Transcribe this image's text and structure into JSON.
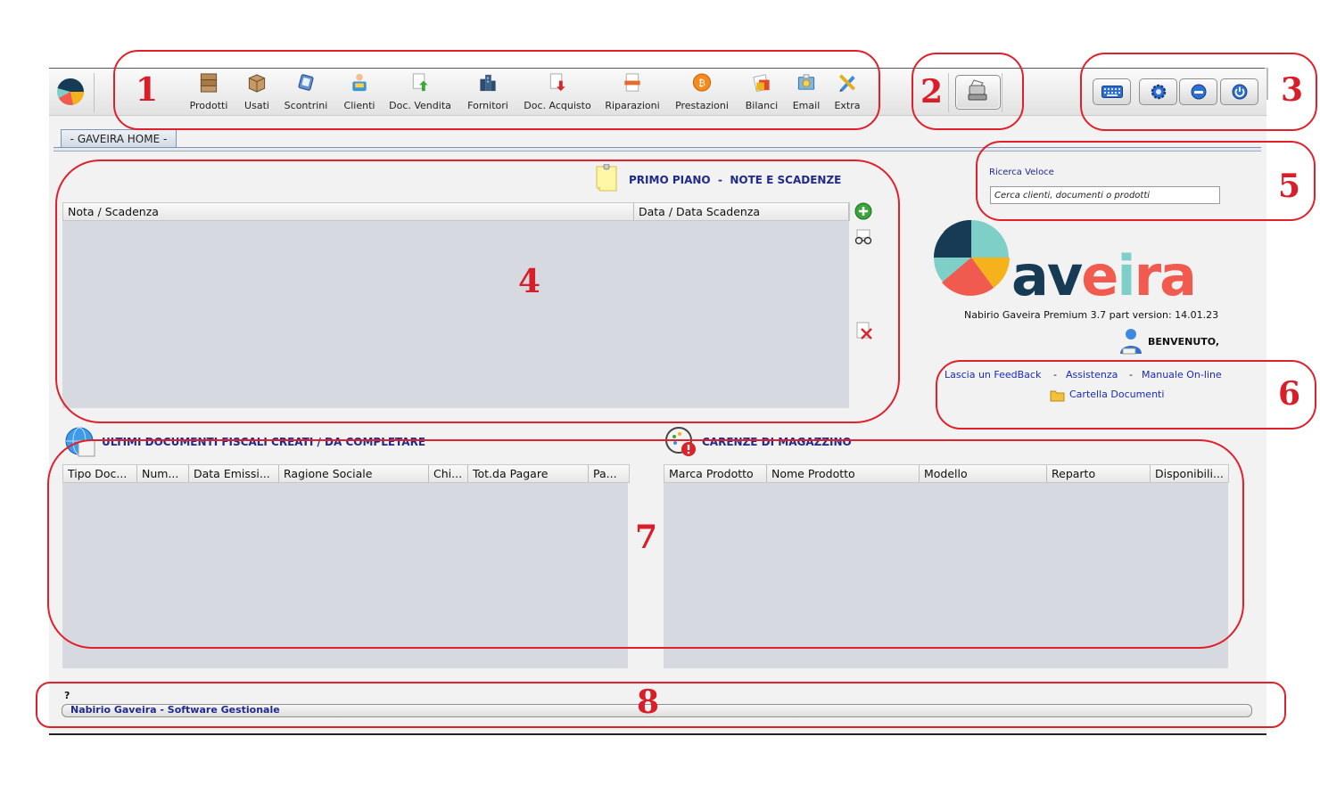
{
  "toolbar": {
    "items": [
      {
        "label": "Prodotti",
        "icon": "products-boxes-icon"
      },
      {
        "label": "Usati",
        "icon": "used-box-icon"
      },
      {
        "label": "Scontrini",
        "icon": "receipt-printer-icon"
      },
      {
        "label": "Clienti",
        "icon": "clients-icon"
      },
      {
        "label": "Doc. Vendita",
        "icon": "sales-document-icon"
      },
      {
        "label": "Fornitori",
        "icon": "suppliers-icon"
      },
      {
        "label": "Doc. Acquisto",
        "icon": "purchase-document-icon"
      },
      {
        "label": "Riparazioni",
        "icon": "repairs-icon"
      },
      {
        "label": "Prestazioni",
        "icon": "services-icon"
      },
      {
        "label": "Bilanci",
        "icon": "balances-icon"
      },
      {
        "label": "Email",
        "icon": "email-icon"
      },
      {
        "label": "Extra",
        "icon": "extra-tools-icon"
      }
    ]
  },
  "tab": {
    "label": "- GAVEIRA HOME -"
  },
  "notes": {
    "title_left": "PRIMO PIANO",
    "title_sep": "-",
    "title_right": "NOTE E SCADENZE",
    "columns": [
      "Nota / Scadenza",
      "Data / Data Scadenza"
    ]
  },
  "docs": {
    "title": "ULTIMI DOCUMENTI FISCALI CREATI / DA COMPLETARE",
    "columns": [
      "Tipo Doc...",
      "Num...",
      "Data Emissi...",
      "Ragione Sociale",
      "Chi...",
      "Tot.da Pagare",
      "Pa..."
    ]
  },
  "stock": {
    "title": "CARENZE DI MAGAZZINO",
    "columns": [
      "Marca Prodotto",
      "Nome Prodotto",
      "Modello",
      "Reparto",
      "Disponibili..."
    ]
  },
  "quick_search": {
    "label": "Ricerca Veloce",
    "placeholder": "Cerca clienti, documenti o prodotti"
  },
  "brand": {
    "logo_text": "aveira"
  },
  "version": "Nabirio Gaveira Premium 3.7 part version: 14.01.23",
  "welcome": "BENVENUTO,",
  "links": {
    "feedback": "Lascia un FeedBack",
    "sep": "-",
    "support": "Assistenza",
    "manual": "Manuale On-line",
    "folder": "Cartella Documenti"
  },
  "status": {
    "question": "?",
    "text": "Nabirio Gaveira - Software Gestionale"
  },
  "annotations": [
    "1",
    "2",
    "3",
    "4",
    "5",
    "6",
    "7",
    "8"
  ],
  "colors": {
    "accent_blue": "#1f2a8a",
    "link_blue": "#1a2ab8",
    "annotation_red": "#e0202a",
    "table_body": "#d6d9e0",
    "logo_navy": "#173a55",
    "logo_teal": "#7ecfc8",
    "logo_coral": "#f05a4f",
    "logo_yellow": "#f6b21b"
  }
}
